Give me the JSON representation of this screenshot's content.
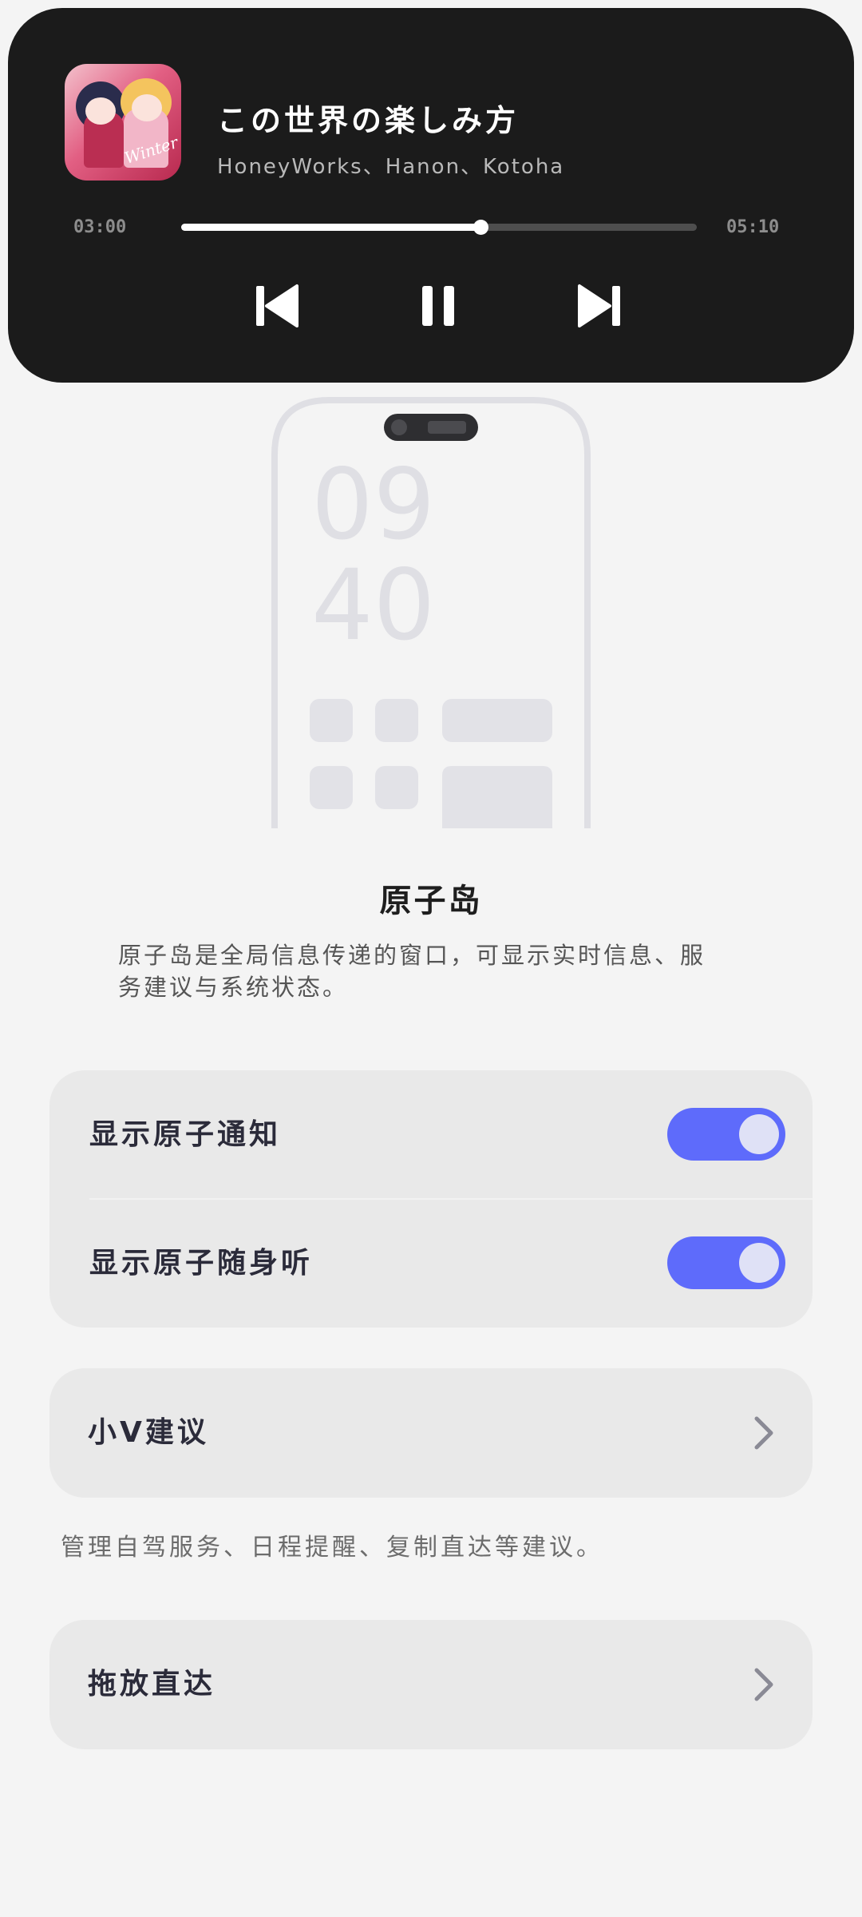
{
  "music_island": {
    "album_art_icon": "album-cover-art",
    "album_art_text": "Winter",
    "title": "この世界の楽しみ方",
    "artist": "HoneyWorks、Hanon、Kotoha",
    "current_time": "03:00",
    "total_time": "05:10",
    "progress_fraction": 0.58,
    "controls": {
      "prev_icon": "skip-previous-icon",
      "pause_icon": "pause-icon",
      "next_icon": "skip-next-icon"
    }
  },
  "illustration": {
    "clock_hour": "09",
    "clock_minute": "40"
  },
  "section": {
    "title": "原子岛",
    "description": "原子岛是全局信息传递的窗口，可显示实时信息、服务建议与系统状态。"
  },
  "settings": {
    "toggles": [
      {
        "label": "显示原子通知",
        "on": true
      },
      {
        "label": "显示原子随身听",
        "on": true
      }
    ],
    "xiaov": {
      "label": "小V建议",
      "chevron_icon": "chevron-right-icon"
    },
    "xiaov_hint": "管理自驾服务、日程提醒、复制直达等建议。",
    "drag": {
      "label": "拖放直达",
      "chevron_icon": "chevron-right-icon"
    }
  },
  "colors": {
    "accent": "#5e6bfb",
    "island_bg": "#1b1b1b",
    "card_bg": "#e9e9e9",
    "page_bg": "#f4f4f4"
  }
}
